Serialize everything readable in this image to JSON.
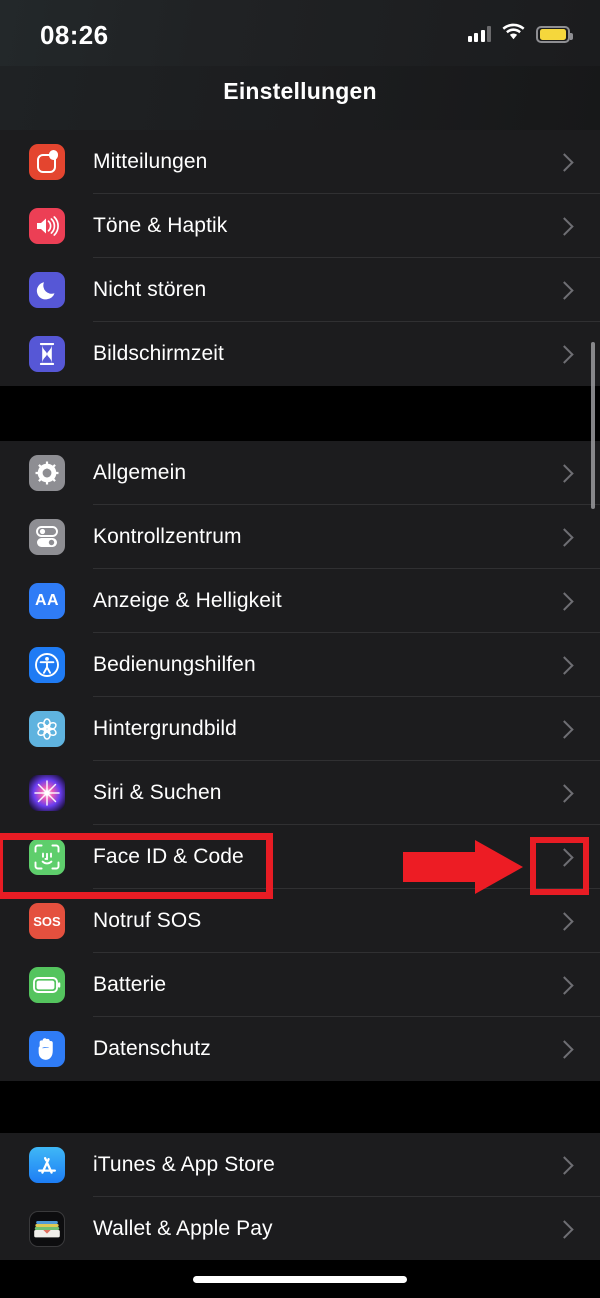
{
  "statusbar": {
    "time": "08:26",
    "signal_icon": "cellular-signal-icon",
    "wifi_icon": "wifi-icon",
    "battery_icon": "battery-icon",
    "battery_color": "#f5d73c"
  },
  "navbar": {
    "title": "Einstellungen"
  },
  "accent": {
    "annotation_red": "#e81c24"
  },
  "groups": [
    {
      "rows": [
        {
          "label": "Mitteilungen",
          "icon": "notifications-icon",
          "icon_color": "#e4452f"
        },
        {
          "label": "Töne & Haptik",
          "icon": "sounds-icon",
          "icon_color": "#ec3f55"
        },
        {
          "label": "Nicht stören",
          "icon": "do-not-disturb-icon",
          "icon_color": "#5657d6"
        },
        {
          "label": "Bildschirmzeit",
          "icon": "screen-time-icon",
          "icon_color": "#5657d6"
        }
      ]
    },
    {
      "rows": [
        {
          "label": "Allgemein",
          "icon": "gear-icon",
          "icon_color": "#8e8e93"
        },
        {
          "label": "Kontrollzentrum",
          "icon": "control-center-icon",
          "icon_color": "#8e8e93"
        },
        {
          "label": "Anzeige & Helligkeit",
          "icon": "display-icon",
          "icon_color": "#2f7cf6"
        },
        {
          "label": "Bedienungshilfen",
          "icon": "accessibility-icon",
          "icon_color": "#1f7bf4"
        },
        {
          "label": "Hintergrundbild",
          "icon": "wallpaper-icon",
          "icon_color": "#5fb3df"
        },
        {
          "label": "Siri & Suchen",
          "icon": "siri-icon",
          "icon_color": "#6a3df0"
        },
        {
          "label": "Face ID & Code",
          "icon": "face-id-icon",
          "icon_color": "#5ece6c"
        },
        {
          "label": "Notruf SOS",
          "icon": "sos-icon",
          "icon_color": "#e4503e"
        },
        {
          "label": "Batterie",
          "icon": "battery-settings-icon",
          "icon_color": "#54c45e"
        },
        {
          "label": "Datenschutz",
          "icon": "privacy-hand-icon",
          "icon_color": "#2f7cf6"
        }
      ]
    },
    {
      "rows": [
        {
          "label": "iTunes & App Store",
          "icon": "app-store-icon",
          "icon_color": "#1d7df5"
        },
        {
          "label": "Wallet & Apple Pay",
          "icon": "wallet-icon",
          "icon_color": "#0d0d0f"
        }
      ]
    }
  ],
  "annotations": {
    "highlight_row_label": "Face ID & Code",
    "arrow_direction": "right",
    "box_color": "#e81c24"
  },
  "icons": {
    "display_glyph": "AA",
    "sos_glyph": "SOS",
    "chevron_glyph": "chevron-right-icon",
    "home_indicator": "home-indicator"
  }
}
